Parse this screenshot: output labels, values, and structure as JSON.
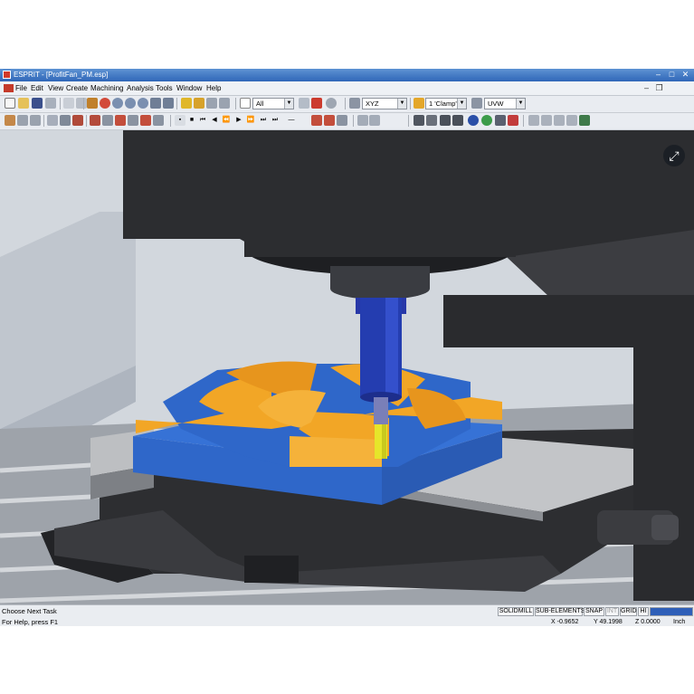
{
  "window": {
    "title": "ESPRIT - [ProfitFan_PM.esp]"
  },
  "menu": [
    {
      "label": "File"
    },
    {
      "label": "Edit"
    },
    {
      "label": "View"
    },
    {
      "label": "Create"
    },
    {
      "label": "Machining"
    },
    {
      "label": "Analysis"
    },
    {
      "label": "Tools"
    },
    {
      "label": "Window"
    },
    {
      "label": "Help"
    }
  ],
  "toolbar": {
    "selection_filter": "All",
    "view_plane": "XYZ",
    "work_plane": "1 'Clamp'",
    "coordinate_mode": "UVW"
  },
  "status": {
    "prompt": "Choose Next Task",
    "help": "For Help, press F1",
    "modes": [
      "SOLIDMILL",
      "SUB-ELEMENTS",
      "SNAP",
      "INT",
      "GRID",
      "HI"
    ],
    "x": "X -0.9652",
    "y": "Y 49.1998",
    "z": "Z 0.0000",
    "units": "Inch"
  },
  "colors": {
    "titlebar": "#3a74c4",
    "part_blue": "#2f67c9",
    "pocket_orange": "#f2a626",
    "tool_blue": "#243db0",
    "tool_tip": "#e6e62a",
    "machine_dark": "#2a2b2e"
  }
}
